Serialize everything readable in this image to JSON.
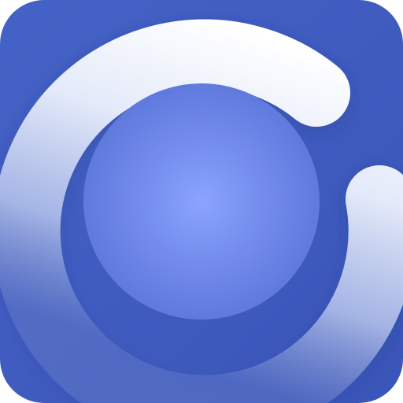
{
  "icon": {
    "background_color": "#3F5BC0",
    "background_color_edge": "#3A55B8",
    "ring_light_color": "#FFFFFF",
    "ring_fade_color": "#AFC0EE",
    "center_color_light": "#8AA4FF",
    "center_color_dark": "#5B75DA",
    "icon_name": "circular-loading-app-icon"
  }
}
